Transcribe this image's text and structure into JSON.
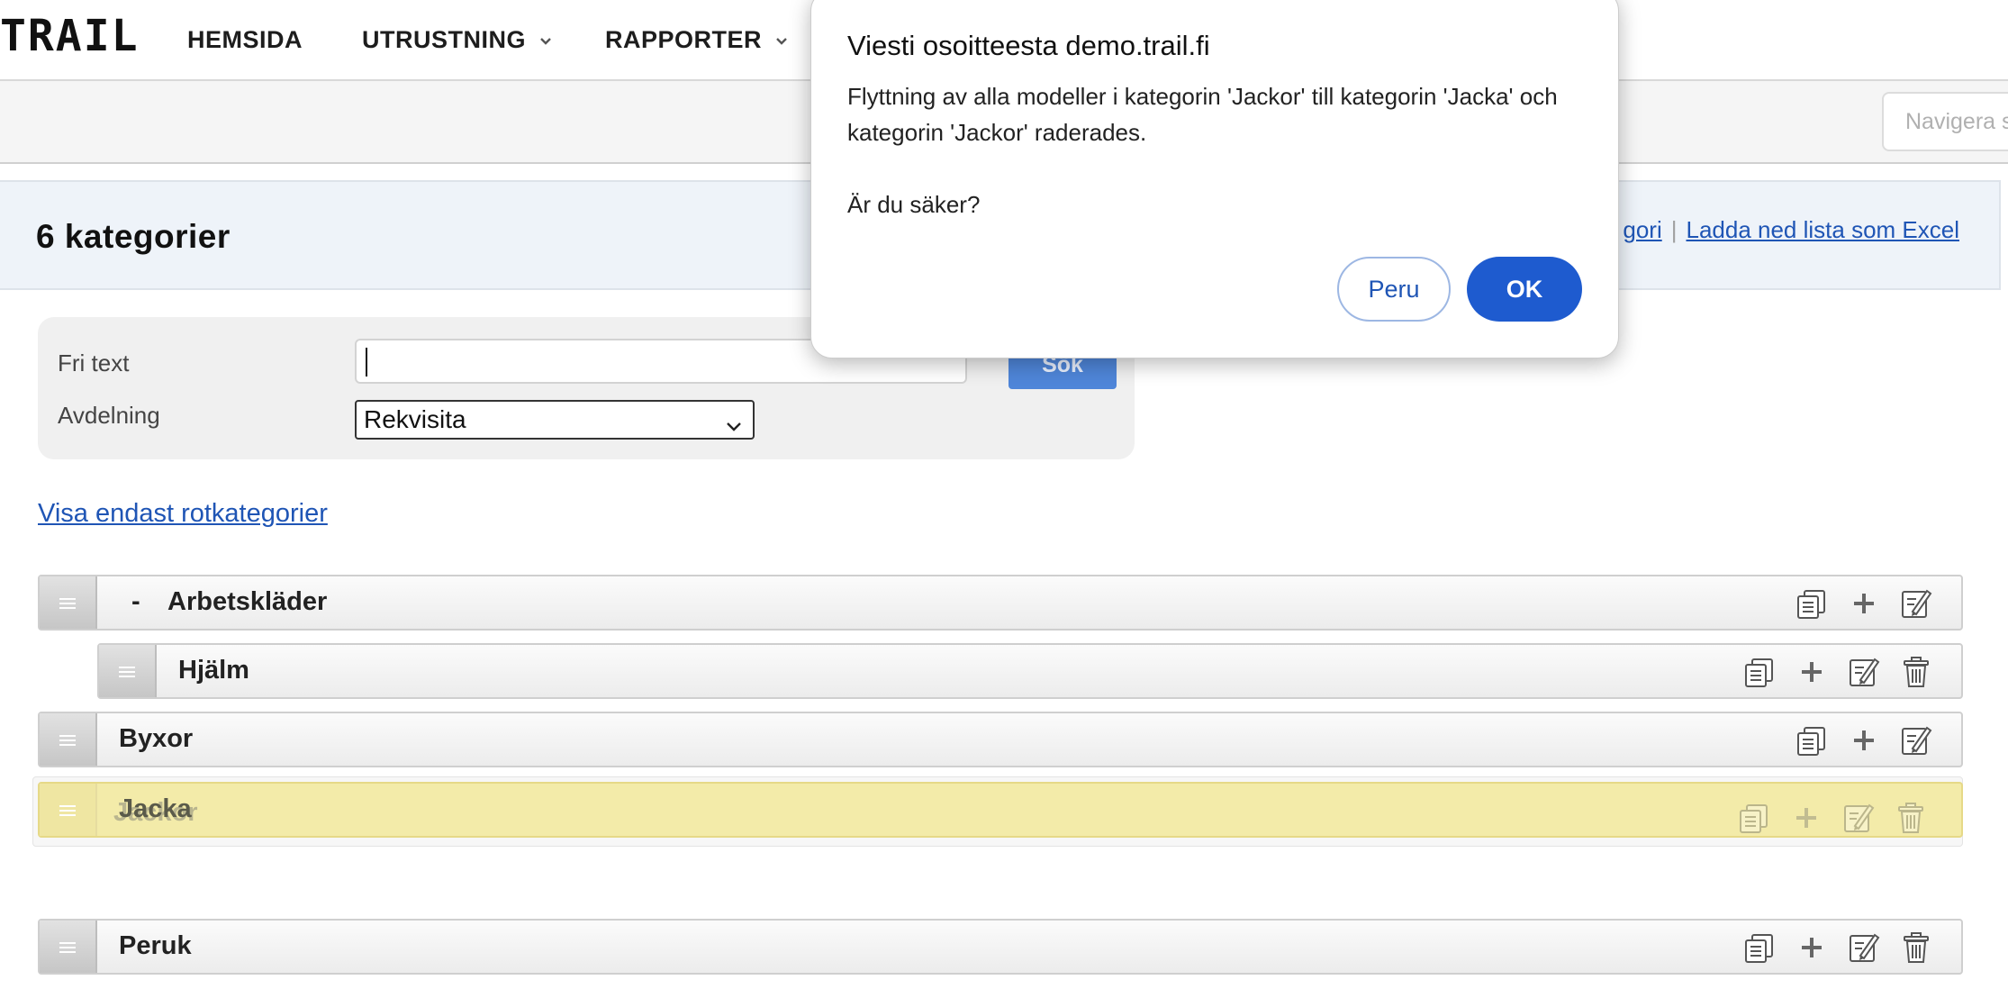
{
  "app": {
    "logo": "TRAIL"
  },
  "nav": {
    "items": [
      {
        "label": "HEMSIDA"
      },
      {
        "label": "UTRUSTNING"
      },
      {
        "label": "RAPPORTER"
      }
    ],
    "navigate_placeholder": "Navigera s"
  },
  "header": {
    "title": "6 kategorier",
    "links": [
      "gori",
      "Ladda ned lista som Excel"
    ]
  },
  "filter": {
    "free_text_label": "Fri text",
    "free_text_value": "",
    "department_label": "Avdelning",
    "department_value": "Rekvisita",
    "search_label": "Sök"
  },
  "root_link": "Visa endast rotkategorier",
  "categories": [
    {
      "label": "Arbetskläder",
      "sign": "-"
    },
    {
      "label": "Hjälm"
    },
    {
      "label": "Byxor"
    },
    {
      "label": "Jacka",
      "ghost_label": "Jackor"
    },
    {
      "label": "Peruk"
    }
  ],
  "dialog": {
    "title": "Viesti osoitteesta demo.trail.fi",
    "message": "Flyttning av alla modeller i kategorin 'Jackor' till kategorin 'Jacka' och kategorin 'Jackor' raderades.\n\nÄr du säker?",
    "cancel_label": "Peru",
    "ok_label": "OK"
  },
  "colors": {
    "accent": "#1e5bcf",
    "link": "#1f55b5",
    "drag_highlight": "#f3eba9"
  }
}
